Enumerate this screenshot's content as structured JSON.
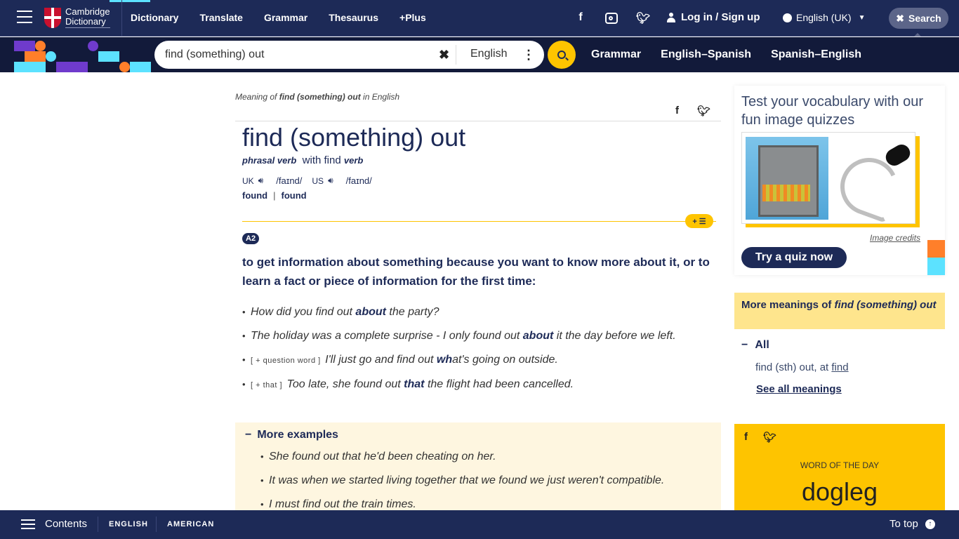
{
  "header": {
    "logo_line1": "Cambridge",
    "logo_line2": "Dictionary",
    "nav": [
      "Dictionary",
      "Translate",
      "Grammar",
      "Thesaurus",
      "+Plus"
    ],
    "login_label": "Log in / Sign up",
    "language": "English (UK)",
    "search_toggle_label": "Search",
    "social": {
      "facebook": "f",
      "twitter": "🐦"
    }
  },
  "search": {
    "query": "find (something) out",
    "dataset": "English",
    "subnav": [
      "Grammar",
      "English–Spanish",
      "Spanish–English"
    ]
  },
  "entry": {
    "meaning_of_prefix": "Meaning of ",
    "meaning_of_word": "find (something) out",
    "meaning_of_suffix": " in English",
    "headword": "find (something) out",
    "pos": "phrasal verb",
    "with_text": "with find",
    "with_pos": "verb",
    "pron": {
      "uk_label": "UK",
      "uk_ipa": "/faɪnd/",
      "us_label": "US",
      "us_ipa": "/faɪnd/"
    },
    "inflections": [
      "found",
      "found"
    ],
    "level": "A2",
    "definition": "to get information about something because you want to know more about it, or to learn a fact or piece of information for the first time:",
    "examples": [
      {
        "gram": "",
        "pre": "How did you find out ",
        "bold": "about",
        "post": " the party?"
      },
      {
        "gram": "",
        "pre": "The holiday was a complete surprise - I only found out ",
        "bold": "about",
        "post": " it the day before we left."
      },
      {
        "gram": "[ + question word ]",
        "pre": "I'll just go and find out ",
        "bold": "wh",
        "post": "at's going on outside."
      },
      {
        "gram": "[ + that ]",
        "pre": "Too late, she found out ",
        "bold": "that",
        "post": " the flight had been cancelled."
      }
    ],
    "more_examples_label": "More examples",
    "more_examples": [
      "She found out that he'd been cheating on her.",
      "It was when we started living together that we found we just weren't compatible.",
      "I must find out the train times."
    ]
  },
  "sidebar": {
    "quiz_title": "Test your vocabulary with our fun image quizzes",
    "image_credits": "Image credits",
    "try_quiz": "Try a quiz now",
    "more_meanings_prefix": "More meanings of ",
    "more_meanings_word": "find (something) out",
    "all_label": "All",
    "mm_entry_text": "find (sth) out, at ",
    "mm_entry_link": "find",
    "see_all": "See all meanings",
    "wotd_label": "WORD OF THE DAY",
    "wotd_word": "dogleg"
  },
  "footer": {
    "contents": "Contents",
    "tabs": [
      "ENGLISH",
      "AMERICAN"
    ],
    "to_top": "To top"
  },
  "colors": {
    "navy": "#1d2a57",
    "yellow": "#fec400",
    "light_yellow": "#fee58d",
    "cream": "#fef6e0",
    "cyan": "#5ce2ff",
    "orange": "#ff7f2a",
    "purple": "#6f3bcc"
  }
}
